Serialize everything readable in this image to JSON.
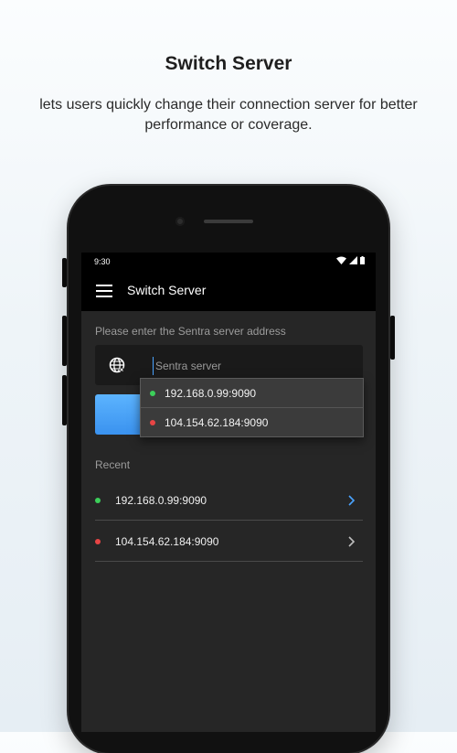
{
  "header": {
    "title": "Switch Server",
    "subtitle": "lets users quickly change their connection server for better performance or coverage."
  },
  "status_bar": {
    "time": "9:30"
  },
  "app_bar": {
    "title": "Switch Server",
    "menu_icon": "hamburger-menu-icon"
  },
  "form": {
    "prompt": "Please enter the Sentra server address",
    "input_placeholder": "Sentra server",
    "input_value": "",
    "input_icon": "globe-icon"
  },
  "suggestions": [
    {
      "address": "192.168.0.99:9090",
      "status_color": "#3ccf5a"
    },
    {
      "address": "104.154.62.184:9090",
      "status_color": "#e84545"
    }
  ],
  "recent": {
    "label": "Recent",
    "items": [
      {
        "address": "192.168.0.99:9090",
        "status_color": "#3ccf5a",
        "chevron_color": "#4aa3ff"
      },
      {
        "address": "104.154.62.184:9090",
        "status_color": "#e84545",
        "chevron_color": "#bdbdbd"
      }
    ]
  },
  "colors": {
    "accent": "#4aa3ff",
    "screen_bg": "#262626",
    "bar_bg": "#000000"
  }
}
